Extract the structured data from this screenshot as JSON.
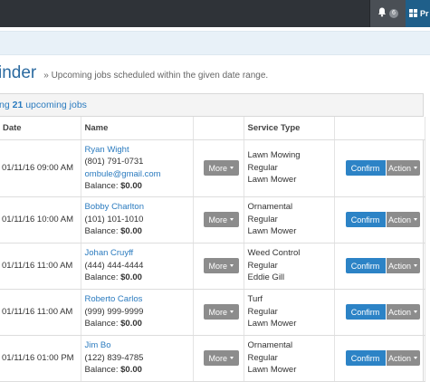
{
  "topbar": {
    "notification_count": "6",
    "project_label": "Pr"
  },
  "page": {
    "title": "inder",
    "subtitle": "» Upcoming jobs scheduled within the given date range."
  },
  "panel": {
    "summary_prefix": "ng",
    "summary_count": "21",
    "summary_suffix": "upcoming jobs"
  },
  "table": {
    "headers": [
      "Date",
      "Name",
      "",
      "Service Type",
      ""
    ],
    "more_label": "More",
    "confirm_label": "Confirm",
    "action_label": "Action",
    "balance_label": "Balance:",
    "rows": [
      {
        "date": "01/11/16 09:00 AM",
        "name": "Ryan Wight",
        "phone": "(801) 791-0731",
        "email": "ombule@gmail.com",
        "balance": "$0.00",
        "service": "Lawn Mowing",
        "frequency": "Regular",
        "assignee": "Lawn Mower"
      },
      {
        "date": "01/11/16 10:00 AM",
        "name": "Bobby Charlton",
        "phone": "(101) 101-1010",
        "balance": "$0.00",
        "service": "Ornamental",
        "frequency": "Regular",
        "assignee": "Lawn Mower"
      },
      {
        "date": "01/11/16 11:00 AM",
        "name": "Johan Cruyff",
        "phone": "(444) 444-4444",
        "balance": "$0.00",
        "service": "Weed Control",
        "frequency": "Regular",
        "assignee": "Eddie Gill"
      },
      {
        "date": "01/11/16 11:00 AM",
        "name": "Roberto Carlos",
        "phone": "(999) 999-9999",
        "balance": "$0.00",
        "service": "Turf",
        "frequency": "Regular",
        "assignee": "Lawn Mower"
      },
      {
        "date": "01/11/16 01:00 PM",
        "name": "Jim Bo",
        "phone": "(122) 839-4785",
        "balance": "$0.00",
        "service": "Ornamental",
        "frequency": "Regular",
        "assignee": "Lawn Mower"
      }
    ]
  }
}
